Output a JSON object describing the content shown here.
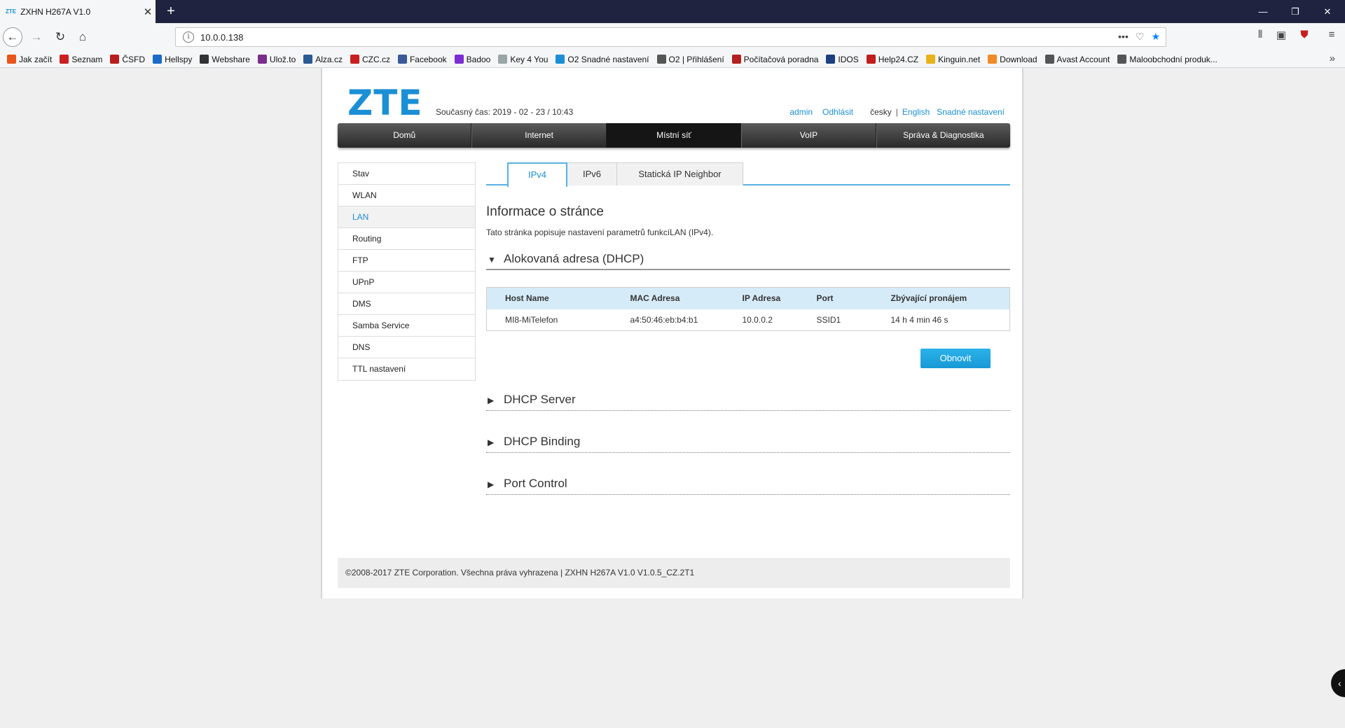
{
  "browser": {
    "tab_favicon": "ZTE",
    "tab_title": "ZXHN H267A V1.0",
    "url": "10.0.0.138",
    "bookmarks": [
      {
        "label": "Jak začít",
        "color": "#e8541a"
      },
      {
        "label": "Seznam",
        "color": "#cc1f1f"
      },
      {
        "label": "ČSFD",
        "color": "#b81d1d"
      },
      {
        "label": "Hellspy",
        "color": "#1b6ac9"
      },
      {
        "label": "Webshare",
        "color": "#333333"
      },
      {
        "label": "Ulož.to",
        "color": "#7a2f8c"
      },
      {
        "label": "Alza.cz",
        "color": "#2a5b95"
      },
      {
        "label": "CZC.cz",
        "color": "#c82020"
      },
      {
        "label": "Facebook",
        "color": "#3b5998"
      },
      {
        "label": "Badoo",
        "color": "#7b2fd3"
      },
      {
        "label": "Key 4 You",
        "color": "#9aa5a5"
      },
      {
        "label": "O2 Snadné nastavení",
        "color": "#1a8fd5"
      },
      {
        "label": "O2 | Přihlášení",
        "color": "#555555"
      },
      {
        "label": "Počítačová poradna",
        "color": "#b42020"
      },
      {
        "label": "IDOS",
        "color": "#1d3f80"
      },
      {
        "label": "Help24.CZ",
        "color": "#c21c1c"
      },
      {
        "label": "Kinguin.net",
        "color": "#e8b21a"
      },
      {
        "label": "Download",
        "color": "#f08a24"
      },
      {
        "label": "Avast Account",
        "color": "#555555"
      },
      {
        "label": "Maloobchodní produk...",
        "color": "#555555"
      }
    ]
  },
  "header": {
    "logo": "ZTE",
    "current_time": "Současný čas: 2019 - 02 - 23 / 10:43",
    "links": {
      "admin": "admin",
      "logout": "Odhlásit",
      "lang_cz": "česky",
      "sep": "|",
      "lang_en": "English",
      "quick_setup": "Snadné nastavení"
    }
  },
  "main_nav": [
    {
      "label": "Domů",
      "active": false
    },
    {
      "label": "Internet",
      "active": false
    },
    {
      "label": "Místní síť",
      "active": true
    },
    {
      "label": "VoIP",
      "active": false
    },
    {
      "label": "Správa & Diagnostika",
      "active": false
    }
  ],
  "sidebar": [
    {
      "label": "Stav",
      "active": false
    },
    {
      "label": "WLAN",
      "active": false
    },
    {
      "label": "LAN",
      "active": true
    },
    {
      "label": "Routing",
      "active": false
    },
    {
      "label": "FTP",
      "active": false
    },
    {
      "label": "UPnP",
      "active": false
    },
    {
      "label": "DMS",
      "active": false
    },
    {
      "label": "Samba Service",
      "active": false
    },
    {
      "label": "DNS",
      "active": false
    },
    {
      "label": "TTL nastavení",
      "active": false
    }
  ],
  "tabs": [
    {
      "label": "IPv4",
      "active": true
    },
    {
      "label": "IPv6",
      "active": false
    },
    {
      "label": "Statická IP Neighbor",
      "active": false
    }
  ],
  "page_info": {
    "title": "Informace o stránce",
    "description": "Tato stránka popisuje nastavení parametrů funkcíLAN (IPv4)."
  },
  "sections": {
    "dhcp_alloc": "Alokovaná adresa (DHCP)",
    "dhcp_server": "DHCP Server",
    "dhcp_binding": "DHCP Binding",
    "port_control": "Port Control"
  },
  "dhcp_table": {
    "headers": [
      "Host Name",
      "MAC Adresa",
      "IP Adresa",
      "Port",
      "Zbývající pronájem"
    ],
    "rows": [
      [
        "MI8-MiTelefon",
        "a4:50:46:eb:b4:b1",
        "10.0.0.2",
        "SSID1",
        "14 h 4 min 46 s"
      ]
    ]
  },
  "buttons": {
    "refresh": "Obnovit"
  },
  "footer": {
    "text": "©2008-2017 ZTE Corporation. Všechna práva vyhrazena  |   ZXHN H267A V1.0 V1.0.5_CZ.2T1"
  }
}
